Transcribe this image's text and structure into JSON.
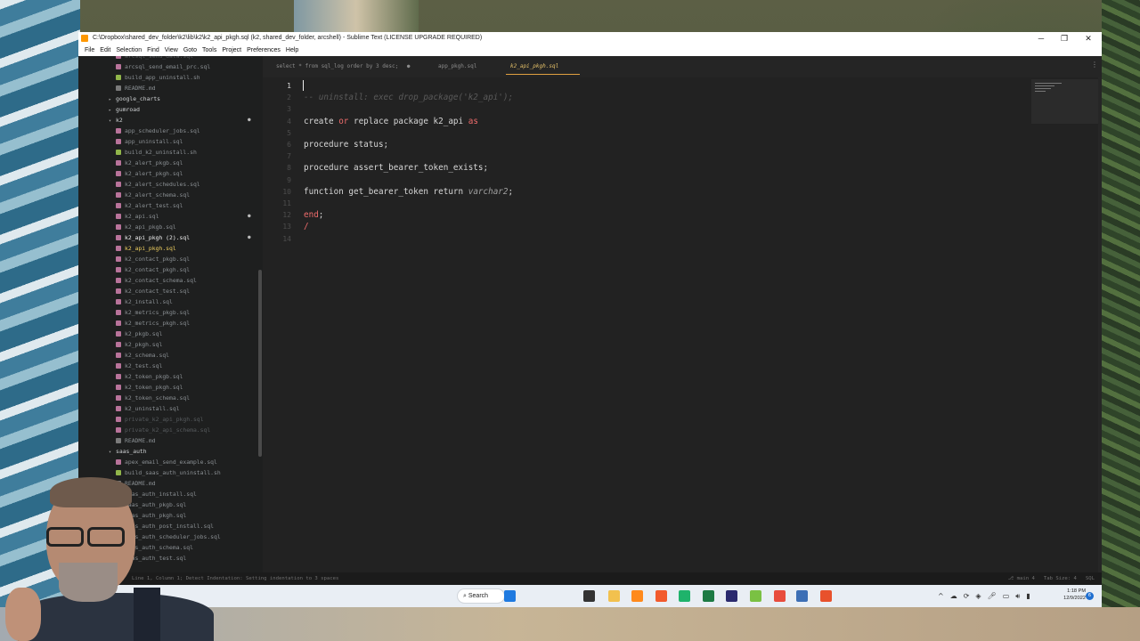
{
  "window": {
    "title": "C:\\Dropbox\\shared_dev_folder\\k2\\lib\\k2\\k2_api_pkgh.sql (k2, shared_dev_folder, arcshell) - Sublime Text (LICENSE UPGRADE REQUIRED)",
    "controls": {
      "minimize": "─",
      "maximize": "❐",
      "close": "✕"
    }
  },
  "menu": [
    "File",
    "Edit",
    "Selection",
    "Find",
    "View",
    "Goto",
    "Tools",
    "Project",
    "Preferences",
    "Help"
  ],
  "sidebar": {
    "rows": [
      {
        "label": "arcsql_send_data.sql",
        "kind": "sql",
        "state": "dim"
      },
      {
        "label": "arcsql_send_email_prc.sql",
        "kind": "sql",
        "state": "normal"
      },
      {
        "label": "build_app_uninstall.sh",
        "kind": "sh",
        "state": "normal"
      },
      {
        "label": "README.md",
        "kind": "md",
        "state": "normal"
      },
      {
        "label": "google_charts",
        "kind": "folder-closed",
        "state": "folder"
      },
      {
        "label": "gumroad",
        "kind": "folder-closed",
        "state": "folder"
      },
      {
        "label": "k2",
        "kind": "folder-open",
        "state": "folder",
        "dot": "●"
      },
      {
        "label": "app_scheduler_jobs.sql",
        "kind": "sql",
        "state": "normal"
      },
      {
        "label": "app_uninstall.sql",
        "kind": "sql",
        "state": "normal"
      },
      {
        "label": "build_k2_uninstall.sh",
        "kind": "sh",
        "state": "normal"
      },
      {
        "label": "k2_alert_pkgb.sql",
        "kind": "sql",
        "state": "normal"
      },
      {
        "label": "k2_alert_pkgh.sql",
        "kind": "sql",
        "state": "normal"
      },
      {
        "label": "k2_alert_schedules.sql",
        "kind": "sql",
        "state": "normal"
      },
      {
        "label": "k2_alert_schema.sql",
        "kind": "sql",
        "state": "normal"
      },
      {
        "label": "k2_alert_test.sql",
        "kind": "sql",
        "state": "normal"
      },
      {
        "label": "k2_api.sql",
        "kind": "sql",
        "state": "normal",
        "dot": "●"
      },
      {
        "label": "k2_api_pkgb.sql",
        "kind": "sql",
        "state": "normal"
      },
      {
        "label": "k2_api_pkgh (2).sql",
        "kind": "sql",
        "state": "active",
        "dot": "●"
      },
      {
        "label": "k2_api_pkgh.sql",
        "kind": "sql",
        "state": "open"
      },
      {
        "label": "k2_contact_pkgb.sql",
        "kind": "sql",
        "state": "normal"
      },
      {
        "label": "k2_contact_pkgh.sql",
        "kind": "sql",
        "state": "normal"
      },
      {
        "label": "k2_contact_schema.sql",
        "kind": "sql",
        "state": "normal"
      },
      {
        "label": "k2_contact_test.sql",
        "kind": "sql",
        "state": "normal"
      },
      {
        "label": "k2_install.sql",
        "kind": "sql",
        "state": "normal"
      },
      {
        "label": "k2_metrics_pkgb.sql",
        "kind": "sql",
        "state": "normal"
      },
      {
        "label": "k2_metrics_pkgh.sql",
        "kind": "sql",
        "state": "normal"
      },
      {
        "label": "k2_pkgb.sql",
        "kind": "sql",
        "state": "normal"
      },
      {
        "label": "k2_pkgh.sql",
        "kind": "sql",
        "state": "normal"
      },
      {
        "label": "k2_schema.sql",
        "kind": "sql",
        "state": "normal"
      },
      {
        "label": "k2_test.sql",
        "kind": "sql",
        "state": "normal"
      },
      {
        "label": "k2_token_pkgb.sql",
        "kind": "sql",
        "state": "normal"
      },
      {
        "label": "k2_token_pkgh.sql",
        "kind": "sql",
        "state": "normal"
      },
      {
        "label": "k2_token_schema.sql",
        "kind": "sql",
        "state": "normal"
      },
      {
        "label": "k2_uninstall.sql",
        "kind": "sql",
        "state": "normal"
      },
      {
        "label": "private_k2_api_pkgh.sql",
        "kind": "sql",
        "state": "dim"
      },
      {
        "label": "private_k2_api_schema.sql",
        "kind": "sql",
        "state": "dim"
      },
      {
        "label": "README.md",
        "kind": "md",
        "state": "normal"
      },
      {
        "label": "saas_auth",
        "kind": "folder-open",
        "state": "folder"
      },
      {
        "label": "apex_email_send_example.sql",
        "kind": "sql",
        "state": "normal"
      },
      {
        "label": "build_saas_auth_uninstall.sh",
        "kind": "sh",
        "state": "normal"
      },
      {
        "label": "README.md",
        "kind": "md",
        "state": "normal"
      },
      {
        "label": "saas_auth_install.sql",
        "kind": "sql",
        "state": "normal"
      },
      {
        "label": "saas_auth_pkgb.sql",
        "kind": "sql",
        "state": "normal"
      },
      {
        "label": "saas_auth_pkgh.sql",
        "kind": "sql",
        "state": "normal"
      },
      {
        "label": "saas_auth_post_install.sql",
        "kind": "sql",
        "state": "normal"
      },
      {
        "label": "saas_auth_scheduler_jobs.sql",
        "kind": "sql",
        "state": "normal"
      },
      {
        "label": "saas_auth_schema.sql",
        "kind": "sql",
        "state": "normal"
      },
      {
        "label": "saas_auth_test.sql",
        "kind": "sql",
        "state": "normal"
      }
    ]
  },
  "tabs": [
    {
      "label": "select * from sql_log order by 3 desc;",
      "modified": "●",
      "active": false
    },
    {
      "label": "app_pkgh.sql",
      "active": false
    },
    {
      "label": "k2_api_pkgh.sql",
      "active": true
    }
  ],
  "tab_menu_icon": "⋮",
  "editor": {
    "current_line": "1",
    "lines": [
      {
        "n": "1",
        "parts": []
      },
      {
        "n": "2",
        "parts": [
          {
            "t": "-- uninstall: exec drop_package('k2_api');",
            "c": "cm"
          }
        ]
      },
      {
        "n": "3",
        "parts": []
      },
      {
        "n": "4",
        "parts": [
          {
            "t": "create ",
            "c": ""
          },
          {
            "t": "or",
            "c": "kw"
          },
          {
            "t": " replace package k2_api ",
            "c": ""
          },
          {
            "t": "as",
            "c": "kw"
          }
        ]
      },
      {
        "n": "5",
        "parts": []
      },
      {
        "n": "6",
        "parts": [
          {
            "t": "procedure status;",
            "c": ""
          }
        ]
      },
      {
        "n": "7",
        "parts": []
      },
      {
        "n": "8",
        "parts": [
          {
            "t": "procedure assert_bearer_token_exists;",
            "c": ""
          }
        ]
      },
      {
        "n": "9",
        "parts": []
      },
      {
        "n": "10",
        "parts": [
          {
            "t": "function get_bearer_token return ",
            "c": ""
          },
          {
            "t": "varchar2",
            "c": "ty"
          },
          {
            "t": ";",
            "c": ""
          }
        ]
      },
      {
        "n": "11",
        "parts": []
      },
      {
        "n": "12",
        "parts": [
          {
            "t": "end",
            "c": "kw"
          },
          {
            "t": ";",
            "c": ""
          }
        ]
      },
      {
        "n": "13",
        "parts": [
          {
            "t": "/",
            "c": "kw"
          }
        ]
      },
      {
        "n": "14",
        "parts": []
      }
    ]
  },
  "status": {
    "message": "Line 1, Column 1; Detect Indentation: Setting indentation to 3 spaces",
    "branch": "main",
    "branch_count": "4",
    "tab_size": "Tab Size: 4",
    "syntax": "SQL"
  },
  "taskbar": {
    "search_label": "Search",
    "clock_time": "1:18 PM",
    "clock_date": "12/9/2022",
    "notifications": "6",
    "icons": [
      {
        "name": "start-icon",
        "color": "#1f7ae0"
      },
      {
        "name": "search-icon",
        "color": "#222222"
      },
      {
        "name": "task-view-icon",
        "color": "#333333"
      },
      {
        "name": "file-explorer-icon",
        "color": "#f2c14e"
      },
      {
        "name": "sublime-text-icon",
        "color": "#ff8a1c"
      },
      {
        "name": "brave-icon",
        "color": "#f25a2c"
      },
      {
        "name": "chrome-app-icon",
        "color": "#1fb36b"
      },
      {
        "name": "excel-icon",
        "color": "#1d7a44"
      },
      {
        "name": "k-app-icon",
        "color": "#2a2a6e"
      },
      {
        "name": "green-c-icon",
        "color": "#7ac143"
      },
      {
        "name": "paint-icon",
        "color": "#e84c3d"
      },
      {
        "name": "settings-icon",
        "color": "#3d6fb5"
      },
      {
        "name": "orange-c-icon",
        "color": "#e8512c"
      }
    ]
  },
  "colors": {
    "accent": "#e9c46a",
    "keyword": "#ef6c6c",
    "editor_bg": "#222222"
  }
}
